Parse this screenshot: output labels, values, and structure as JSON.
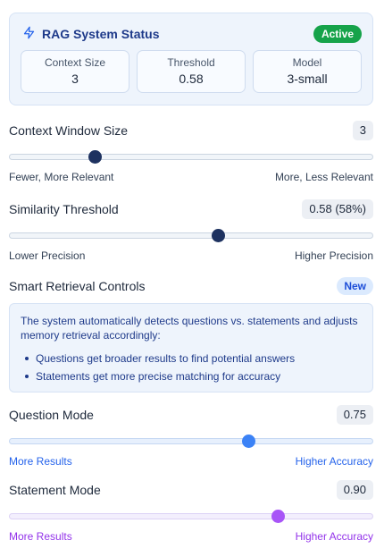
{
  "status_card": {
    "title": "RAG System Status",
    "badge": "Active",
    "stats": [
      {
        "label": "Context Size",
        "value": "3"
      },
      {
        "label": "Threshold",
        "value": "0.58"
      },
      {
        "label": "Model",
        "value": "3-small"
      }
    ]
  },
  "context_window": {
    "label": "Context Window Size",
    "value": "3",
    "level": 0.235,
    "left_label": "Fewer, More Relevant",
    "right_label": "More, Less Relevant"
  },
  "similarity": {
    "label": "Similarity Threshold",
    "value": "0.58 (58%)",
    "level": 0.575,
    "left_label": "Lower Precision",
    "right_label": "Higher Precision"
  },
  "smart_retrieval": {
    "label": "Smart Retrieval Controls",
    "badge": "New",
    "description": "The system automatically detects questions vs. statements and adjusts memory retrieval accordingly:",
    "bullets": [
      "Questions get broader results to find potential answers",
      "Statements get more precise matching for accuracy"
    ]
  },
  "question_mode": {
    "label": "Question Mode",
    "value": "0.75",
    "level": 0.66,
    "left_label": "More Results",
    "right_label": "Higher Accuracy"
  },
  "statement_mode": {
    "label": "Statement Mode",
    "value": "0.90",
    "level": 0.74,
    "left_label": "More Results",
    "right_label": "Higher Accuracy"
  },
  "colors": {
    "accent_navy": "#1e3260",
    "active_green": "#16a34a",
    "question_blue": "#3b82f6",
    "statement_purple": "#a855f7"
  },
  "icons": {
    "status": "lightning-icon"
  }
}
